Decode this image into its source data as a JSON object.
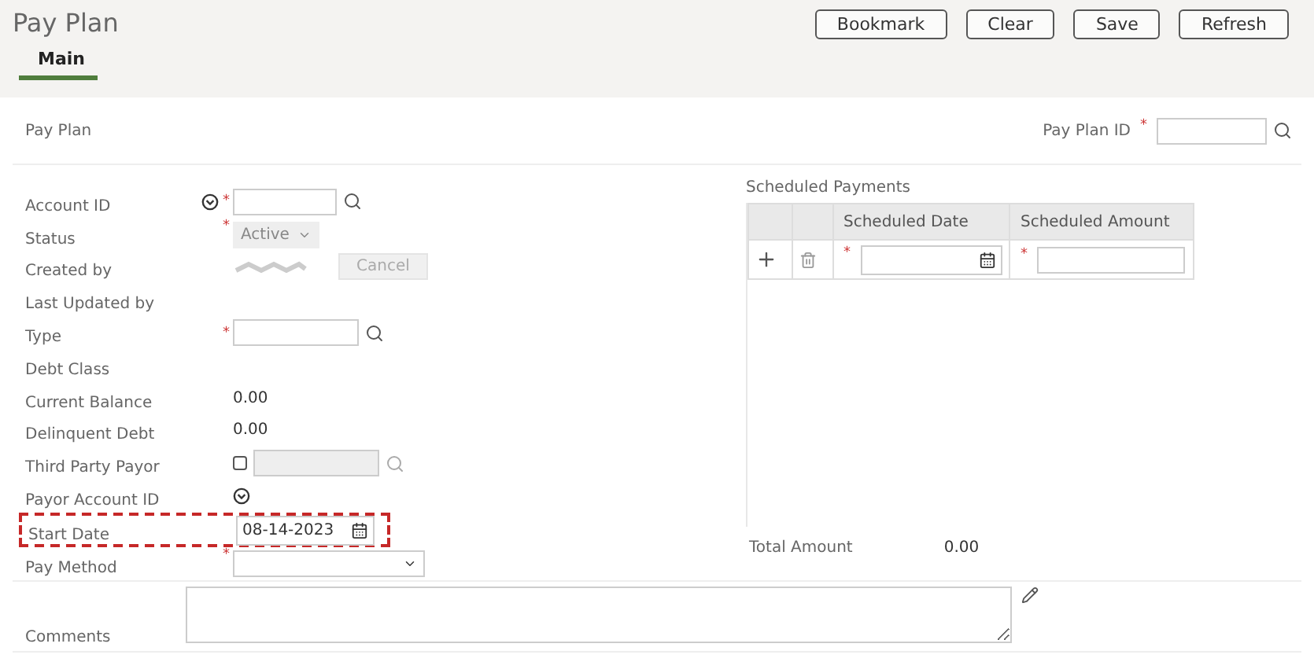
{
  "page": {
    "title": "Pay Plan"
  },
  "actions": [
    "Bookmark",
    "Clear",
    "Save",
    "Refresh"
  ],
  "tabs": [
    {
      "label": "Main",
      "selected": true
    }
  ],
  "section": {
    "title": "Pay Plan",
    "id_label": "Pay Plan ID",
    "id_required": "*"
  },
  "fields": [
    {
      "kind": "lookup",
      "label": "Account ID",
      "required": "*",
      "expander": true
    },
    {
      "kind": "select",
      "label": "Status",
      "required": "*",
      "value": "Active",
      "disabled": true
    },
    {
      "kind": "hidden-value",
      "label": "Created by",
      "button": "Cancel",
      "button_disabled": true
    },
    {
      "kind": "empty",
      "label": "Last Updated by"
    },
    {
      "kind": "lookup",
      "label": "Type",
      "required": "*",
      "expander": false
    },
    {
      "kind": "empty",
      "label": "Debt Class"
    },
    {
      "kind": "value",
      "label": "Current Balance",
      "value": "0.00"
    },
    {
      "kind": "value",
      "label": "Delinquent Debt",
      "value": "0.00"
    },
    {
      "kind": "check-lookup",
      "label": "Third Party Payor",
      "checked": false
    },
    {
      "kind": "expander",
      "label": "Payor Account ID"
    },
    {
      "kind": "date",
      "label": "Start Date",
      "value": "08-14-2023",
      "highlighted": true
    },
    {
      "kind": "select",
      "label": "Pay Method",
      "required": "*",
      "disabled": false
    }
  ],
  "payments": {
    "title": "Scheduled Payments",
    "columns": [
      {
        "label": "Scheduled Date",
        "required": "*"
      },
      {
        "label": "Scheduled Amount",
        "required": "*"
      }
    ],
    "total_label": "Total Amount",
    "total": "0.00"
  },
  "comments": {
    "label": "Comments"
  }
}
